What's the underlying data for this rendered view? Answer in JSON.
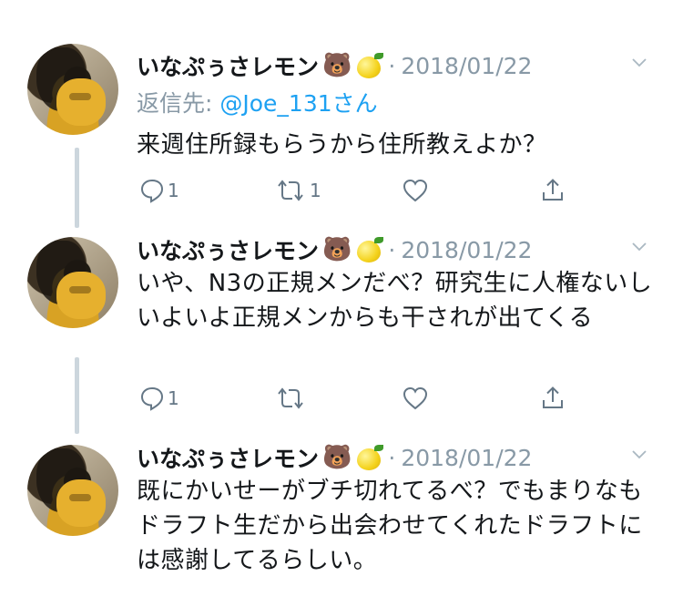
{
  "tweets": [
    {
      "name": "いなぷぅさレモン",
      "emoji_bear": "🐻",
      "date": "2018/01/22",
      "reply_prefix": "返信先: ",
      "reply_handle": "@Joe_131さん",
      "text": "来週住所録もらうから住所教えよか？",
      "reply_count": "1",
      "retweet_count": "1"
    },
    {
      "name": "いなぷぅさレモン",
      "emoji_bear": "🐻",
      "date": "2018/01/22",
      "text": "いや、N3の正規メンだべ？研究生に人権ないしいよいよ正規メンからも干されが出てくる",
      "reply_count": "1",
      "retweet_count": ""
    },
    {
      "name": "いなぷぅさレモン",
      "emoji_bear": "🐻",
      "date": "2018/01/22",
      "text": "既にかいせーがブチ切れてるべ？でもまりなもドラフト生だから出会わせてくれたドラフトには感謝してるらしい。"
    }
  ],
  "separator": "·",
  "icons": {
    "reply": "speech-bubble-icon",
    "retweet": "retweet-arrows-icon",
    "like": "heart-icon",
    "share": "share-upload-icon",
    "menu": "chevron-down-icon"
  },
  "colors": {
    "text": "#14171a",
    "muted": "#8899a6",
    "link": "#1da1f2",
    "thread_line": "#ccd6dd"
  }
}
